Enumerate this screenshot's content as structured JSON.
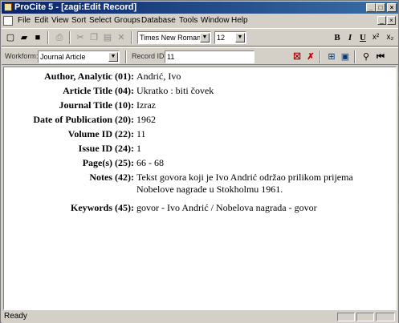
{
  "window": {
    "title": "ProCite 5 - [zagi:Edit Record]",
    "controls": {
      "minimize": "_",
      "maximize": "□",
      "close": "×"
    }
  },
  "menu": {
    "items": [
      {
        "label": "File",
        "underline": "F"
      },
      {
        "label": "Edit",
        "underline": "E"
      },
      {
        "label": "View",
        "underline": "V"
      },
      {
        "label": "Sort",
        "underline": "S"
      },
      {
        "label": "Select",
        "underline": "S"
      },
      {
        "label": "Groups",
        "underline": "G"
      },
      {
        "label": "Database",
        "underline": "D"
      },
      {
        "label": "Tools",
        "underline": "T"
      },
      {
        "label": "Window",
        "underline": "W"
      },
      {
        "label": "Help",
        "underline": "H"
      }
    ]
  },
  "toolbar": {
    "font_value": "Times New Roman",
    "size_value": "12",
    "icons": {
      "new": "new-document-icon",
      "open": "open-folder-icon",
      "save": "save-disk-icon",
      "print": "print-icon",
      "cut": "cut-icon",
      "copy": "copy-icon",
      "paste": "paste-icon",
      "delete": "delete-icon",
      "bold": "bold-icon",
      "italic": "italic-icon",
      "underline": "underline-icon",
      "superscript": "superscript-icon",
      "subscript": "subscript-icon"
    },
    "glyphs": {
      "bold": "B",
      "italic": "I",
      "underline": "U",
      "superscript": "x²",
      "subscript": "x₂"
    }
  },
  "recordbar": {
    "workform_label": "Workform:",
    "workform_value": "Journal Article",
    "record_label": "Record ID:",
    "record_value": "11"
  },
  "record": {
    "fields": [
      {
        "label": "Author, Analytic (01):",
        "value": "Andrić, Ivo"
      },
      {
        "label": "Article Title (04):",
        "value": "Ukratko : biti čovek"
      },
      {
        "label": "Journal Title (10):",
        "value": "Izraz"
      },
      {
        "label": "Date of Publication (20):",
        "value": "1962"
      },
      {
        "label": "Volume ID (22):",
        "value": "11"
      },
      {
        "label": "Issue ID (24):",
        "value": "1"
      },
      {
        "label": "Page(s) (25):",
        "value": "66 - 68"
      },
      {
        "label": "Notes (42):",
        "value": "Tekst govora koji je Ivo Andrić održao prilikom prijema Nobelove nagrade u Stokholmu 1961."
      },
      {
        "label": "Keywords (45):",
        "value": "govor - Ivo Andrić / Nobelova nagrada - govor"
      }
    ]
  },
  "statusbar": {
    "text": "Ready"
  }
}
